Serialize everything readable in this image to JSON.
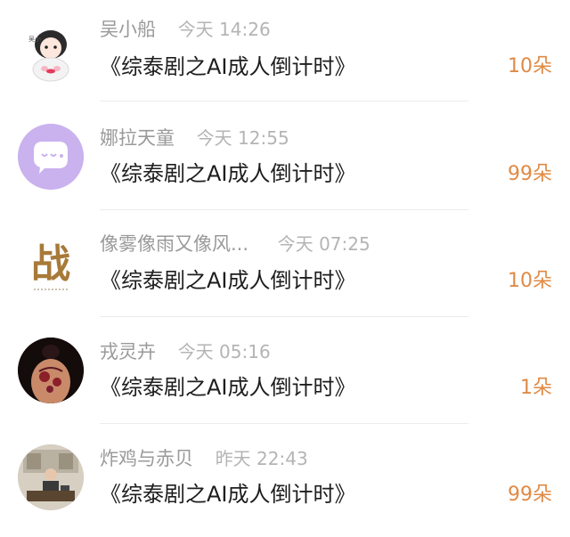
{
  "items": [
    {
      "user": "吴小船",
      "time": "今天 14:26",
      "title": "《综泰剧之AI成人倒计时》",
      "count": "10朵",
      "avatar": "anime-girl-avatar"
    },
    {
      "user": "娜拉天童",
      "time": "今天 12:55",
      "title": "《综泰剧之AI成人倒计时》",
      "count": "99朵",
      "avatar": "purple-chat-avatar"
    },
    {
      "user": "像雾像雨又像风...",
      "time": "今天 07:25",
      "title": "《综泰剧之AI成人倒计时》",
      "count": "10朵",
      "avatar": "calligraphy-avatar",
      "avatar_char": "战"
    },
    {
      "user": "戎灵卉",
      "time": "今天 05:16",
      "title": "《综泰剧之AI成人倒计时》",
      "count": "1朵",
      "avatar": "tattoo-back-avatar"
    },
    {
      "user": "炸鸡与赤贝",
      "time": "昨天 22:43",
      "title": "《综泰剧之AI成人倒计时》",
      "count": "99朵",
      "avatar": "office-photo-avatar"
    }
  ],
  "colors": {
    "count": "#e08a45",
    "meta": "#9a9a9a",
    "title": "#1e1e1e",
    "purple_avatar": "#c9b2ee"
  }
}
